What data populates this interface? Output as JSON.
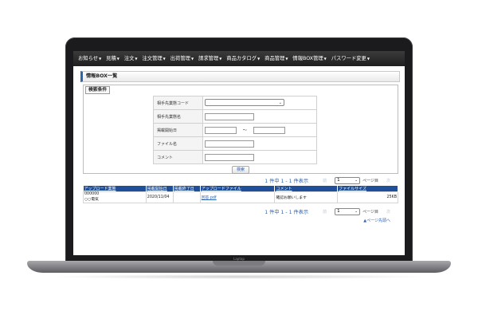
{
  "device": {
    "brand": "Laptop"
  },
  "menu": [
    "お知らせ",
    "見積",
    "注文",
    "注文管理",
    "出荷管理",
    "請求管理",
    "商品カタログ",
    "商品管理",
    "情報BOX管理",
    "パスワード変更"
  ],
  "page": {
    "title": "情報BOX一覧"
  },
  "search": {
    "tab_label": "検索条件",
    "fields": {
      "partner_code": "相手先業態コード",
      "partner_name": "相手先業態名",
      "start_date": "掲載開始日",
      "file_name": "ファイル名",
      "comment": "コメント"
    },
    "range_sep": "～",
    "button": "検索"
  },
  "pager": {
    "count_text": "1 件中 1 - 1 件表示",
    "prev": "前",
    "next": "次",
    "page": "1",
    "page_label": "ページ目"
  },
  "results": {
    "columns": [
      "アップロード業態",
      "掲載開始日",
      "掲載終了日",
      "アップロードファイル",
      "コメント",
      "ファイルサイズ"
    ],
    "rows": [
      {
        "code": "000000",
        "name": "○○電気",
        "start": "2020/11/04",
        "end": "",
        "file": "回答.pdf",
        "comment": "確認お願いします",
        "size": "25KB"
      }
    ]
  },
  "page_top": "▲ページ先頭へ"
}
